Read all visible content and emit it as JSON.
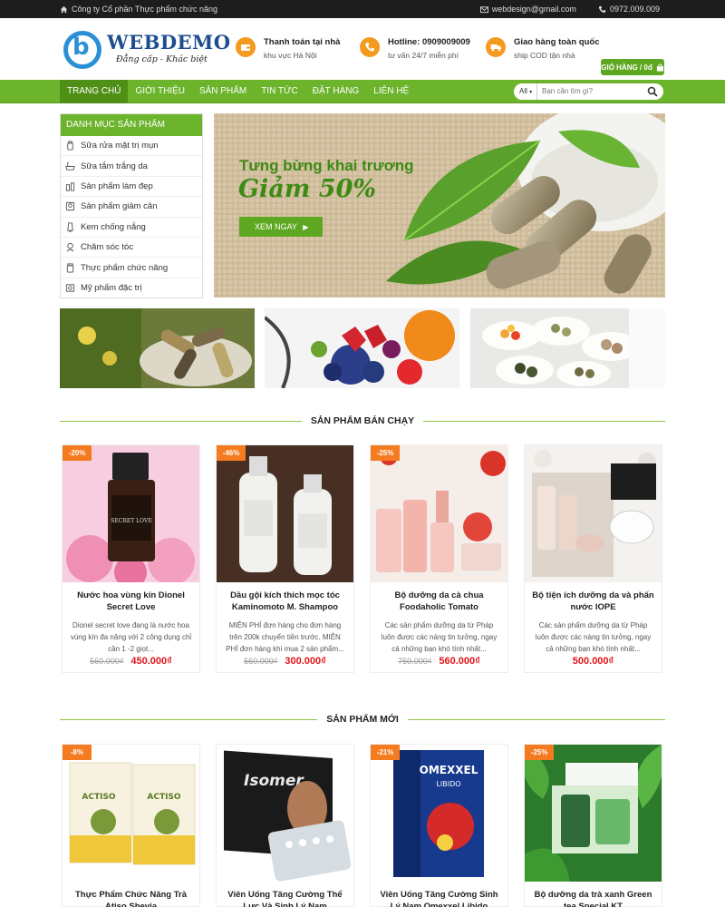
{
  "topbar": {
    "company": "Công ty Cổ phần Thực phẩm chức năng",
    "email": "webdesign@gmail.com",
    "phone": "0972.009.009"
  },
  "header": {
    "logo_text": "WEBDEMO",
    "logo_tagline": "Đẳng cấp - Khác biệt",
    "info": [
      {
        "title": "Thanh toán tại nhà",
        "sub": "khu vực Hà Nội",
        "icon": "wallet-icon"
      },
      {
        "title": "Hotline: 0909009009",
        "sub": "tư vấn 24/7 miễn phí",
        "icon": "phone-icon"
      },
      {
        "title": "Giao hàng toàn quốc",
        "sub": "ship COD tận nhà",
        "icon": "truck-icon"
      }
    ],
    "cart_label": "GIỎ HÀNG / 0đ"
  },
  "nav": {
    "items": [
      "TRANG CHỦ",
      "GIỚI THIỆU",
      "SẢN PHẨM",
      "TIN TỨC",
      "ĐẶT HÀNG",
      "LIÊN HỆ"
    ],
    "search_scope": "All",
    "search_placeholder": "Bạn cần tìm gì?"
  },
  "sidebar": {
    "title": "DANH MỤC SẢN PHẨM",
    "items": [
      "Sữa rửa mặt trị mụn",
      "Sữa tắm trắng da",
      "Sản phẩm làm đẹp",
      "Sản phẩm giảm cân",
      "Kem chống nắng",
      "Chăm sóc tóc",
      "Thực phẩm chức năng",
      "Mỹ phẩm đặc trị"
    ]
  },
  "banner": {
    "line1": "Tưng bừng khai trương",
    "line2": "Giảm 50%",
    "cta": "XEM NGAY"
  },
  "bestsellers": {
    "title": "SẢN PHẨM BÁN CHẠY",
    "products": [
      {
        "badge": "-20%",
        "name": "Nước hoa vùng kín Dionel Secret Love",
        "desc": "Dionel secret love đang là nước hoa vùng kín đa năng với 2 công dụng chỉ cần 1 -2 giọt...",
        "old_price": "560.000₫",
        "price": "450.000₫"
      },
      {
        "badge": "-46%",
        "name": "Dầu gội kích thích mọc tóc Kaminomoto M. Shampoo",
        "desc": "MIỄN PHÍ đơn hàng cho đơn hàng trên 200k chuyển tiền trước. MIỄN PHÍ đơn hàng khi mua 2 sản phẩm...",
        "old_price": "560.000₫",
        "price": "300.000₫"
      },
      {
        "badge": "-25%",
        "name": "Bộ dưỡng da cà chua Foodaholic Tomato",
        "desc": "Các sản phẩm dưỡng da từ Pháp luôn được các nàng tin tưởng, ngay cả những bạn khó tính nhất...",
        "old_price": "750.000₫",
        "price": "560.000₫"
      },
      {
        "badge": "",
        "name": "Bộ tiện ích dưỡng da và phấn nước IOPE",
        "desc": "Các sản phẩm dưỡng da từ Pháp luôn được các nàng tin tưởng, ngay cả những bạn khó tính nhất...",
        "old_price": "",
        "price": "500.000₫"
      }
    ]
  },
  "new_products": {
    "title": "SẢN PHẨM MỚI",
    "products": [
      {
        "badge": "-8%",
        "name": "Thực Phẩm Chức Năng Trà Atiso Shevia"
      },
      {
        "badge": "",
        "name": "Viên Uống Tăng Cường Thể Lực Và Sinh Lý Nam"
      },
      {
        "badge": "-21%",
        "name": "Viên Uống Tăng Cường Sinh Lý Nam Omexxel Libido"
      },
      {
        "badge": "-25%",
        "name": "Bộ dưỡng da trà xanh Green tea Special KT"
      }
    ]
  },
  "colors": {
    "brand_green": "#6cb42c",
    "accent_orange": "#f39a1f",
    "price_red": "#e0141a",
    "badge_orange": "#f47b20"
  }
}
